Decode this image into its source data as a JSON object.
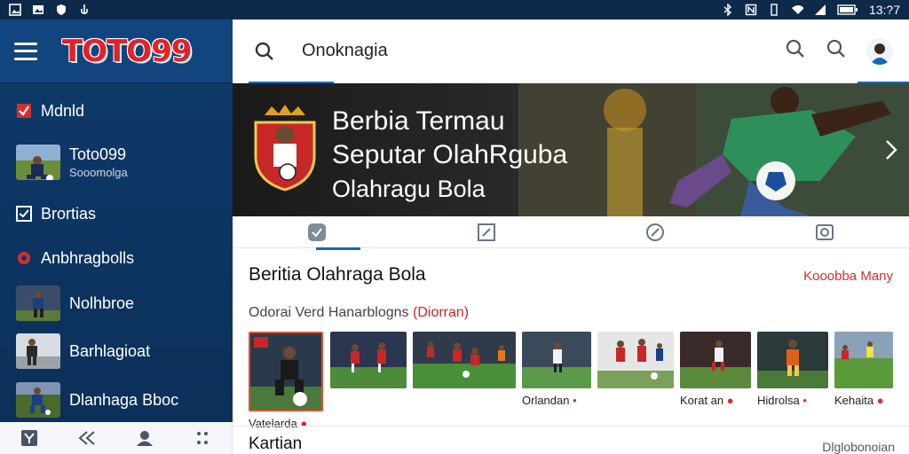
{
  "status": {
    "time": "13:?7"
  },
  "sidebar": {
    "logo": "TOTO99",
    "items": [
      {
        "label": "Mdnld",
        "icon": "check-square-icon"
      },
      {
        "label": "Toto099",
        "sub": "Sooomolga",
        "thumb": "player-thumb"
      },
      {
        "label": "Brortias",
        "icon": "checkbox-icon"
      },
      {
        "label": "Anbhragbolls",
        "icon": "soccer-icon"
      },
      {
        "label": "Nolhbroe",
        "thumb": "player-thumb"
      },
      {
        "label": "Barhlagioat",
        "thumb": "player-thumb"
      },
      {
        "label": "Dlanhaga Bboc",
        "thumb": "player-thumb"
      }
    ]
  },
  "topbar": {
    "title": "Onoknagia"
  },
  "hero": {
    "line1": "Berbia Termau",
    "line2": "Seputar OlahRguba",
    "line3": "Olahragu Bola"
  },
  "section": {
    "title": "Beritia Olahraga Bola",
    "link": "Kooobba Many",
    "sub_prefix": "Odorai Verd Hanarblogns ",
    "sub_highlight": "(Diorran)"
  },
  "cards": [
    {
      "caption": "Vatelarda",
      "badge": "●"
    },
    {
      "caption": ""
    },
    {
      "caption": ""
    },
    {
      "caption": "Orlandan",
      "badge": "•"
    },
    {
      "caption": ""
    },
    {
      "caption": "Korat an",
      "badge": "●"
    },
    {
      "caption": "Hidrolsa",
      "badge": "•"
    },
    {
      "caption": "Kehaita",
      "badge": "●"
    }
  ],
  "footer": {
    "title": "Kartian",
    "link": "Dlglobonoian"
  },
  "colors": {
    "brand": "#e62027",
    "nav": "#0f3a6b",
    "accent": "#1565c0"
  }
}
